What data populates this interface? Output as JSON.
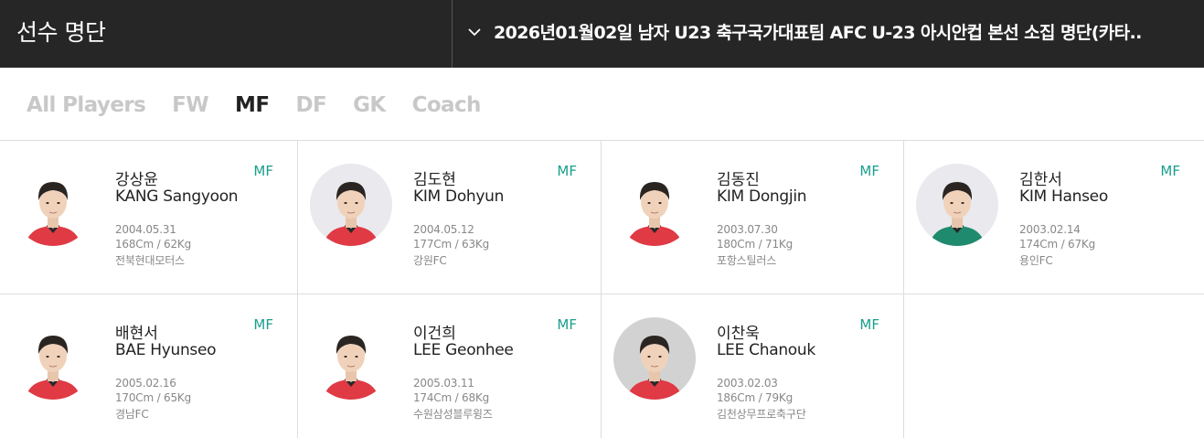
{
  "header": {
    "title": "선수 명단",
    "selector_text": "2026년01월02일 남자 U23 축구국가대표팀 AFC U-23 아시안컵 본선 소집 명단(카타.."
  },
  "tabs": [
    {
      "label": "All Players",
      "active": false
    },
    {
      "label": "FW",
      "active": false
    },
    {
      "label": "MF",
      "active": true
    },
    {
      "label": "DF",
      "active": false
    },
    {
      "label": "GK",
      "active": false
    },
    {
      "label": "Coach",
      "active": false
    }
  ],
  "colors": {
    "accent_position": "#1a9e8c",
    "topbar": "#262626",
    "kit_red": "#e03a45",
    "kit_green": "#1f8a6e"
  },
  "players": [
    {
      "name_ko": "강상윤",
      "name_en": "KANG Sangyoon",
      "position": "MF",
      "birth": "2004.05.31",
      "body": "168Cm / 62Kg",
      "club": "전북현대모터스",
      "kit": "red",
      "photo_bg": "#ffffff"
    },
    {
      "name_ko": "김도현",
      "name_en": "KIM Dohyun",
      "position": "MF",
      "birth": "2004.05.12",
      "body": "177Cm / 63Kg",
      "club": "강원FC",
      "kit": "red",
      "photo_bg": "#e9e9ee"
    },
    {
      "name_ko": "김동진",
      "name_en": "KIM Dongjin",
      "position": "MF",
      "birth": "2003.07.30",
      "body": "180Cm / 71Kg",
      "club": "포항스틸러스",
      "kit": "red",
      "photo_bg": "#ffffff"
    },
    {
      "name_ko": "김한서",
      "name_en": "KIM Hanseo",
      "position": "MF",
      "birth": "2003.02.14",
      "body": "174Cm / 67Kg",
      "club": "용인FC",
      "kit": "green",
      "photo_bg": "#e9e9ee"
    },
    {
      "name_ko": "배현서",
      "name_en": "BAE Hyunseo",
      "position": "MF",
      "birth": "2005.02.16",
      "body": "170Cm / 65Kg",
      "club": "경남FC",
      "kit": "red",
      "photo_bg": "#ffffff"
    },
    {
      "name_ko": "이건희",
      "name_en": "LEE Geonhee",
      "position": "MF",
      "birth": "2005.03.11",
      "body": "174Cm / 68Kg",
      "club": "수원삼성블루윙즈",
      "kit": "red",
      "photo_bg": "#ffffff"
    },
    {
      "name_ko": "이찬욱",
      "name_en": "LEE Chanouk",
      "position": "MF",
      "birth": "2003.02.03",
      "body": "186Cm / 79Kg",
      "club": "김천상무프로축구단",
      "kit": "red",
      "photo_bg": "#d2d2d2"
    }
  ]
}
